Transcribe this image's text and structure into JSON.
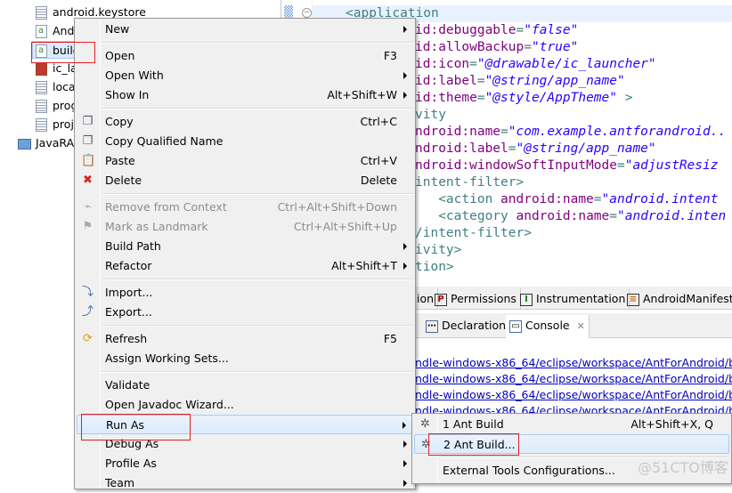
{
  "tree": {
    "items": [
      {
        "label": "android.keystore",
        "icon": "text-file-icon"
      },
      {
        "label": "And",
        "icon": "android-file-icon"
      },
      {
        "label": "build",
        "icon": "android-file-icon"
      },
      {
        "label": "ic_la",
        "icon": "image-file-icon"
      },
      {
        "label": "loca",
        "icon": "text-file-icon"
      },
      {
        "label": "prog",
        "icon": "text-file-icon"
      },
      {
        "label": "proj",
        "icon": "text-file-icon"
      }
    ],
    "project": {
      "label": "JavaRA",
      "icon": "folder-icon"
    }
  },
  "editor": {
    "lines": [
      {
        "parts": [
          [
            "tag",
            "<application"
          ]
        ]
      },
      {
        "parts": [
          [
            "attr",
            "id:debuggable"
          ],
          [
            "tag",
            "="
          ],
          [
            "val",
            "\"false\""
          ]
        ]
      },
      {
        "parts": [
          [
            "attr",
            "id:allowBackup"
          ],
          [
            "tag",
            "="
          ],
          [
            "val",
            "\"true\""
          ]
        ]
      },
      {
        "parts": [
          [
            "attr",
            "id:icon"
          ],
          [
            "tag",
            "="
          ],
          [
            "val",
            "\"@drawable/ic_launcher\""
          ]
        ]
      },
      {
        "parts": [
          [
            "attr",
            "id:label"
          ],
          [
            "tag",
            "="
          ],
          [
            "val",
            "\"@string/app_name\""
          ]
        ]
      },
      {
        "parts": [
          [
            "attr",
            "id:theme"
          ],
          [
            "tag",
            "="
          ],
          [
            "val",
            "\"@style/AppTheme\""
          ],
          [
            "tag",
            " >"
          ]
        ]
      },
      {
        "parts": [
          [
            "tag",
            "vity"
          ]
        ]
      },
      {
        "parts": [
          [
            "attr",
            "ndroid:name"
          ],
          [
            "tag",
            "="
          ],
          [
            "val",
            "\"com.example.antforandroid.."
          ]
        ]
      },
      {
        "parts": [
          [
            "attr",
            "ndroid:label"
          ],
          [
            "tag",
            "="
          ],
          [
            "val",
            "\"@string/app_name\""
          ]
        ]
      },
      {
        "parts": [
          [
            "attr",
            "ndroid:windowSoftInputMode"
          ],
          [
            "tag",
            "="
          ],
          [
            "val",
            "\"adjustResiz"
          ]
        ]
      },
      {
        "parts": [
          [
            "tag",
            "intent-filter>"
          ]
        ]
      },
      {
        "parts": [
          [
            "tag",
            "   <action "
          ],
          [
            "attr",
            "android:name"
          ],
          [
            "tag",
            "="
          ],
          [
            "val",
            "\"android.intent"
          ]
        ]
      },
      {
        "parts": [
          [
            "tag",
            "   <category "
          ],
          [
            "attr",
            "android:name"
          ],
          [
            "tag",
            "="
          ],
          [
            "val",
            "\"android.inten"
          ]
        ]
      },
      {
        "parts": [
          [
            "tag",
            "/intent-filter>"
          ]
        ]
      },
      {
        "parts": [
          [
            "tag",
            "ivity>"
          ]
        ]
      },
      {
        "parts": [
          [
            "tag",
            "tion>"
          ]
        ]
      }
    ]
  },
  "manifest_tabs": [
    {
      "label": "ion",
      "icon": ""
    },
    {
      "label": "Permissions",
      "icon": "permissions-icon",
      "glyph": "P"
    },
    {
      "label": "Instrumentation",
      "icon": "instrumentation-icon",
      "glyph": "I"
    },
    {
      "label": "AndroidManifest",
      "icon": "xml-file-icon",
      "glyph": "≡"
    }
  ],
  "view_tabs": [
    {
      "label": "Declaration",
      "icon": "declaration-icon"
    },
    {
      "label": "Console",
      "icon": "console-icon",
      "close": "✕"
    }
  ],
  "console": {
    "lines": [
      "ndle-windows-x86_64/eclipse/workspace/AntForAndroid/bin/p",
      "ndle-windows-x86_64/eclipse/workspace/AntForAndroid/bin/",
      "ndle-windows-x86_64/eclipse/workspace/AntForAndroid/build",
      "ndle-windows-x86_64/eclipse/workspace/AntForAndroid/buil"
    ]
  },
  "context_menu": {
    "groups": [
      [
        {
          "label": "New",
          "submenu": true
        }
      ],
      [
        {
          "label": "Open",
          "shortcut": "F3"
        },
        {
          "label": "Open With",
          "submenu": true
        },
        {
          "label": "Show In",
          "shortcut": "Alt+Shift+W",
          "submenu": true
        }
      ],
      [
        {
          "label": "Copy",
          "shortcut": "Ctrl+C",
          "icon": "copy-icon"
        },
        {
          "label": "Copy Qualified Name",
          "icon": "copy-qualified-name-icon"
        },
        {
          "label": "Paste",
          "shortcut": "Ctrl+V",
          "icon": "paste-icon"
        },
        {
          "label": "Delete",
          "shortcut": "Delete",
          "icon": "delete-icon"
        }
      ],
      [
        {
          "label": "Remove from Context",
          "shortcut": "Ctrl+Alt+Shift+Down",
          "disabled": true,
          "icon": "remove-context-icon"
        },
        {
          "label": "Mark as Landmark",
          "shortcut": "Ctrl+Alt+Shift+Up",
          "disabled": true,
          "icon": "landmark-icon"
        },
        {
          "label": "Build Path",
          "submenu": true
        },
        {
          "label": "Refactor",
          "shortcut": "Alt+Shift+T",
          "submenu": true
        }
      ],
      [
        {
          "label": "Import...",
          "icon": "import-icon"
        },
        {
          "label": "Export...",
          "icon": "export-icon"
        }
      ],
      [
        {
          "label": "Refresh",
          "shortcut": "F5",
          "icon": "refresh-icon"
        },
        {
          "label": "Assign Working Sets..."
        }
      ],
      [
        {
          "label": "Validate"
        },
        {
          "label": "Open Javadoc Wizard..."
        },
        {
          "label": "Run As",
          "submenu": true,
          "selected": true
        },
        {
          "label": "Debug As",
          "submenu": true
        },
        {
          "label": "Profile As",
          "submenu": true
        },
        {
          "label": "Team",
          "submenu": true
        }
      ]
    ]
  },
  "run_as_submenu": {
    "items": [
      {
        "label": "1 Ant Build",
        "shortcut": "Alt+Shift+X, Q",
        "icon": "ant-icon"
      },
      {
        "label": "2 Ant Build...",
        "icon": "ant-icon",
        "selected": true
      }
    ],
    "footer": "External Tools Configurations..."
  },
  "watermark": "@51CTO博客",
  "colors": {
    "highlight_box": "#e02020",
    "selection": "#dcebfc",
    "link": "#0000c0"
  }
}
